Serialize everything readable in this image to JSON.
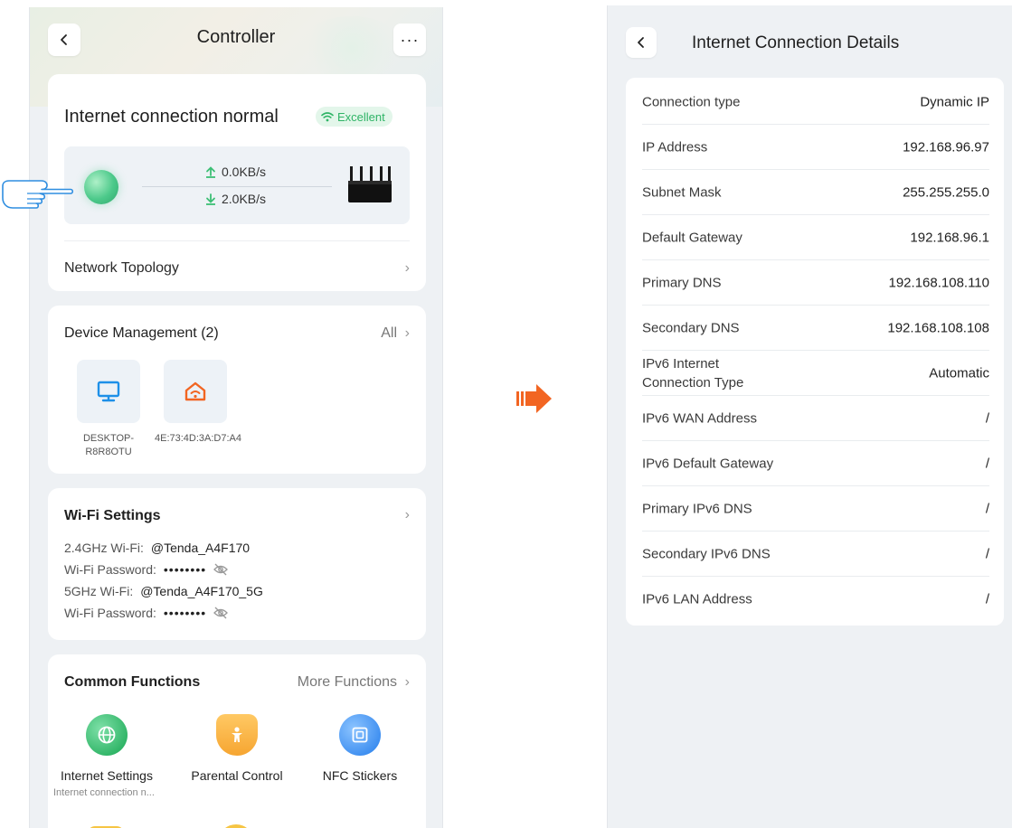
{
  "controller": {
    "title": "Controller",
    "status_text": "Internet connection normal",
    "quality_badge": "Excellent",
    "upload_speed": "0.0KB/s",
    "download_speed": "2.0KB/s",
    "network_topology": "Network Topology",
    "device_management": {
      "title": "Device Management (2)",
      "all_link": "All",
      "devices": [
        {
          "label": "DESKTOP-R8R8OTU",
          "icon": "monitor-icon"
        },
        {
          "label": "4E:73:4D:3A:D7:A4",
          "icon": "smart-home-icon"
        }
      ]
    },
    "wifi_settings": {
      "title": "Wi-Fi Settings",
      "band_24_label": "2.4GHz Wi-Fi:",
      "band_24_ssid": "@Tenda_A4F170",
      "band_5_label": "5GHz Wi-Fi:",
      "band_5_ssid": "@Tenda_A4F170_5G",
      "password_label": "Wi-Fi Password:",
      "password_mask": "••••••••"
    },
    "common_functions": {
      "title": "Common Functions",
      "more_link": "More Functions",
      "items": [
        {
          "label": "Internet Settings",
          "sub": "Internet connection n...",
          "icon": "globe-icon"
        },
        {
          "label": "Parental Control",
          "icon": "child-shield-icon"
        },
        {
          "label": "NFC Stickers",
          "icon": "nfc-icon"
        }
      ]
    }
  },
  "details": {
    "title": "Internet Connection Details",
    "rows": [
      {
        "label": "Connection type",
        "value": "Dynamic IP"
      },
      {
        "label": "IP Address",
        "value": "192.168.96.97"
      },
      {
        "label": "Subnet Mask",
        "value": "255.255.255.0"
      },
      {
        "label": "Default Gateway",
        "value": "192.168.96.1"
      },
      {
        "label": "Primary DNS",
        "value": "192.168.108.110"
      },
      {
        "label": "Secondary DNS",
        "value": "192.168.108.108"
      },
      {
        "label_line1": "IPv6 Internet",
        "label_line2": "Connection Type",
        "value": "Automatic"
      },
      {
        "label": "IPv6 WAN Address",
        "value": "/"
      },
      {
        "label": "IPv6 Default Gateway",
        "value": "/"
      },
      {
        "label": "Primary IPv6 DNS",
        "value": "/"
      },
      {
        "label": "Secondary IPv6 DNS",
        "value": "/"
      },
      {
        "label": "IPv6 LAN Address",
        "value": "/"
      }
    ]
  },
  "colors": {
    "accent_green": "#2fb466",
    "arrow_orange": "#f26522",
    "nfc_blue": "#3d8ef0",
    "parental_orange": "#f6a531"
  }
}
